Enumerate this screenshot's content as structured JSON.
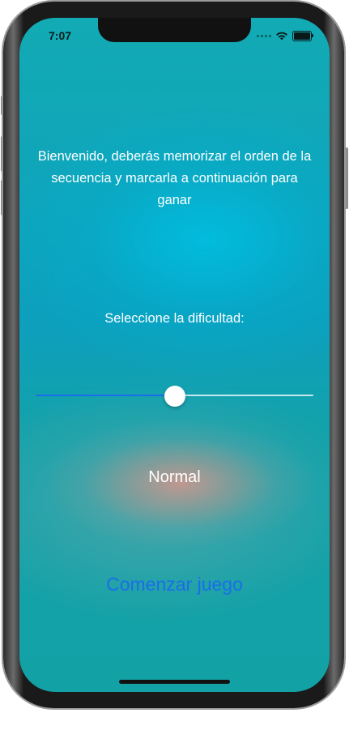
{
  "status_bar": {
    "time": "7:07",
    "icons": [
      "signal-dots-icon",
      "wifi-icon",
      "battery-icon"
    ]
  },
  "main": {
    "welcome_text": "Bienvenido, deberás memorizar el orden de la secuencia y marcarla a continuación para ganar",
    "difficulty_label": "Seleccione la dificultad:",
    "difficulty_slider": {
      "value": 0.5,
      "min": 0,
      "max": 1
    },
    "difficulty_value": "Normal",
    "start_button_label": "Comenzar juego"
  },
  "colors": {
    "accent": "#1a6ee8",
    "text": "#ffffff",
    "background": "#12a2b4"
  }
}
